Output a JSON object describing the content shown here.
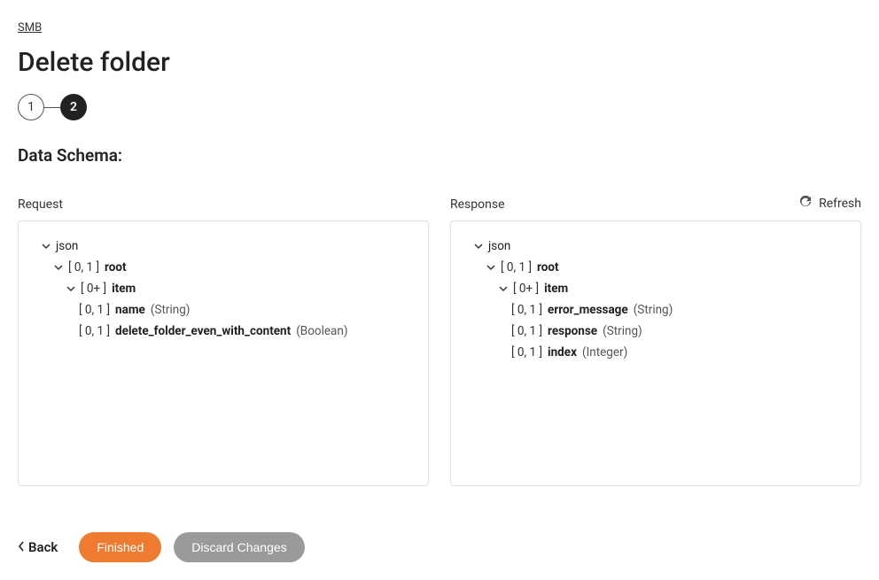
{
  "breadcrumb": "SMB",
  "page_title": "Delete folder",
  "stepper": {
    "step1": "1",
    "step2": "2"
  },
  "schema_heading": "Data Schema:",
  "labels": {
    "request": "Request",
    "response": "Response",
    "refresh": "Refresh"
  },
  "request_tree": {
    "root_label": "json",
    "n1_card": "[ 0, 1 ]",
    "n1_name": "root",
    "n2_card": "[ 0+ ]",
    "n2_name": "item",
    "n3_card": "[ 0, 1 ]",
    "n3_name": "name",
    "n3_type": "(String)",
    "n4_card": "[ 0, 1 ]",
    "n4_name": "delete_folder_even_with_content",
    "n4_type": "(Boolean)"
  },
  "response_tree": {
    "root_label": "json",
    "n1_card": "[ 0, 1 ]",
    "n1_name": "root",
    "n2_card": "[ 0+ ]",
    "n2_name": "item",
    "n3_card": "[ 0, 1 ]",
    "n3_name": "error_message",
    "n3_type": "(String)",
    "n4_card": "[ 0, 1 ]",
    "n4_name": "response",
    "n4_type": "(String)",
    "n5_card": "[ 0, 1 ]",
    "n5_name": "index",
    "n5_type": "(Integer)"
  },
  "footer": {
    "back": "Back",
    "finished": "Finished",
    "discard": "Discard Changes"
  }
}
